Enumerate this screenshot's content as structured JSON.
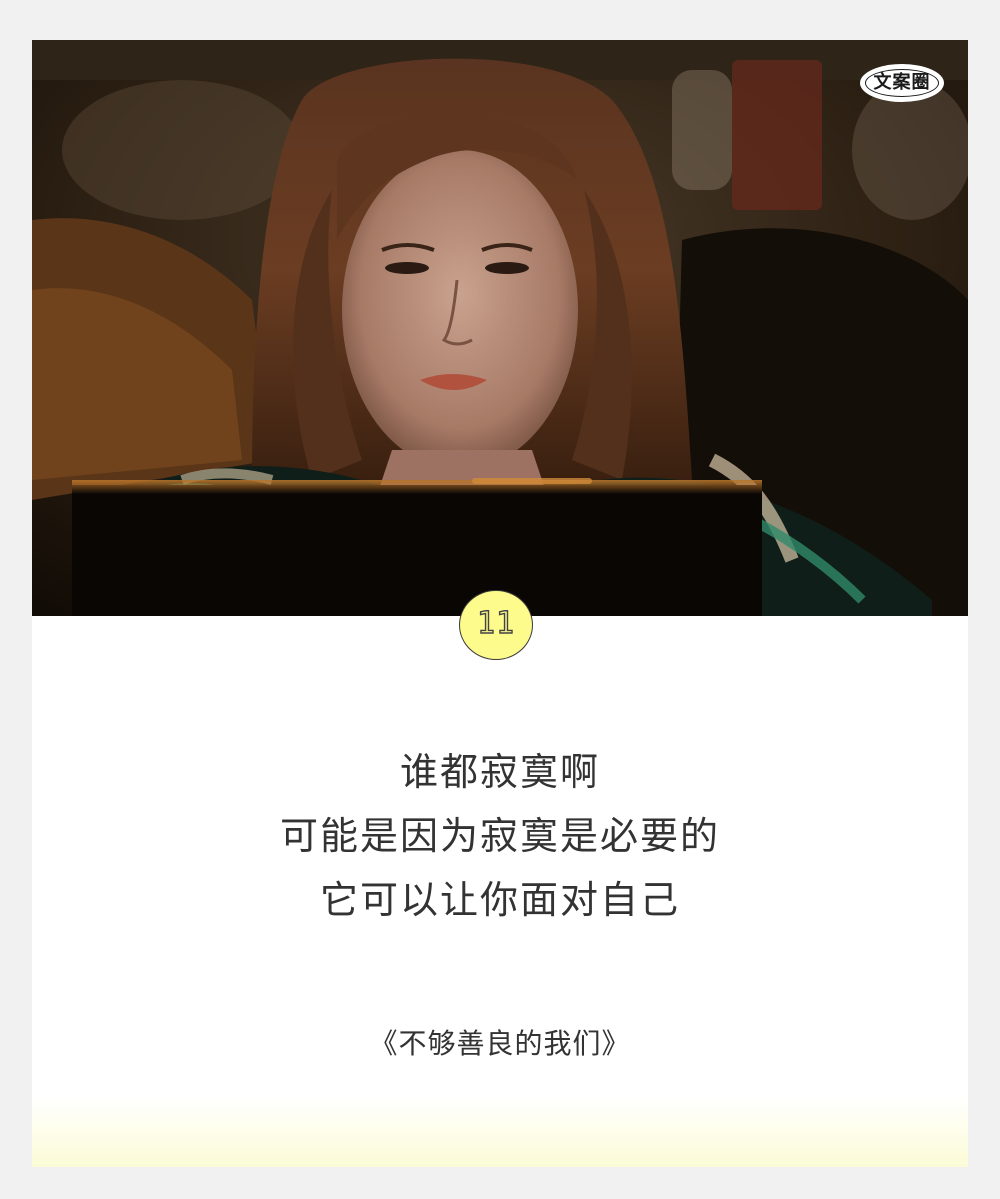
{
  "watermark": {
    "label": "文案圈"
  },
  "badge": {
    "number": "11"
  },
  "quote": {
    "lines": [
      "谁都寂寞啊",
      "可能是因为寂寞是必要的",
      "它可以让你面对自己"
    ]
  },
  "source": {
    "title": "《不够善良的我们》"
  },
  "colors": {
    "page_background": "#f1f1f1",
    "card_background": "#ffffff",
    "badge_fill": "#fdfb8c",
    "text": "#333333",
    "bottom_glow": "#fbfcd6"
  }
}
